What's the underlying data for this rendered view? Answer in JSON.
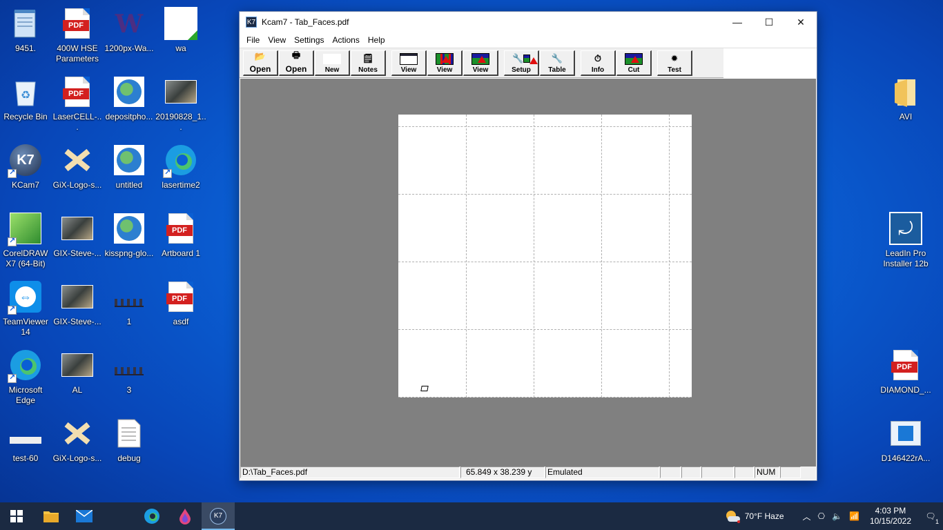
{
  "desktop": {
    "icons": [
      {
        "label": "9451.",
        "kind": "notepad"
      },
      {
        "label": "400W HSE Parameters",
        "kind": "pdf"
      },
      {
        "label": "1200px-Wa...",
        "kind": "w-logo"
      },
      {
        "label": "wa",
        "kind": "qr"
      },
      {
        "label": "Recycle Bin",
        "kind": "recycle"
      },
      {
        "label": "LaserCELL-...",
        "kind": "pdf"
      },
      {
        "label": "depositpho...",
        "kind": "globe"
      },
      {
        "label": "20190828_1...",
        "kind": "photo"
      },
      {
        "label": "KCam7",
        "kind": "kcam"
      },
      {
        "label": "GiX-Logo-s...",
        "kind": "gix"
      },
      {
        "label": "untitled",
        "kind": "globe"
      },
      {
        "label": "lasertime2",
        "kind": "edge"
      },
      {
        "label": "CorelDRAW X7 (64-Bit)",
        "kind": "corel"
      },
      {
        "label": "GIX-Steve-...",
        "kind": "photo"
      },
      {
        "label": "kisspng-glo...",
        "kind": "globe"
      },
      {
        "label": "Artboard 1",
        "kind": "pdf"
      },
      {
        "label": "TeamViewer 14",
        "kind": "teamviewer"
      },
      {
        "label": "GIX-Steve-...",
        "kind": "photo"
      },
      {
        "label": "1",
        "kind": "small"
      },
      {
        "label": "asdf",
        "kind": "pdf"
      },
      {
        "label": "Microsoft Edge",
        "kind": "edge"
      },
      {
        "label": "AL",
        "kind": "photo"
      },
      {
        "label": "3",
        "kind": "small"
      },
      {
        "label": "test-60",
        "kind": "bar"
      },
      {
        "label": "GiX-Logo-s...",
        "kind": "gix"
      },
      {
        "label": "debug",
        "kind": "text"
      },
      {
        "label": "AVI",
        "kind": "folder"
      },
      {
        "label": "LeadIn Pro Installer 12b",
        "kind": "installer"
      },
      {
        "label": "DIAMOND_...",
        "kind": "pdf"
      },
      {
        "label": "D146422rA...",
        "kind": "window"
      }
    ],
    "pdf_tag": "PDF"
  },
  "window": {
    "title": "Kcam7 - Tab_Faces.pdf",
    "app_icon": "K7",
    "controls": {
      "minimize": "—",
      "maximize": "☐",
      "close": "✕"
    },
    "menu": [
      "File",
      "View",
      "Settings",
      "Actions",
      "Help"
    ],
    "toolbar": [
      {
        "label": "Open",
        "icon": "folder-open-icon"
      },
      {
        "label": "Open",
        "icon": "printer-icon"
      },
      {
        "label": "New",
        "icon": "blank-page-icon"
      },
      {
        "label": "Notes",
        "icon": "notepad-icon"
      },
      {
        "label": "View",
        "icon": "view-blank-icon"
      },
      {
        "label": "View",
        "icon": "view-grid-icon"
      },
      {
        "label": "View",
        "icon": "view-image-icon"
      },
      {
        "label": "Setup",
        "icon": "setup-icon"
      },
      {
        "label": "Table",
        "icon": "wrench-icon"
      },
      {
        "label": "Info",
        "icon": "info-clock-icon"
      },
      {
        "label": "Cut",
        "icon": "cut-image-icon"
      },
      {
        "label": "Test",
        "icon": "test-icon"
      }
    ],
    "status": {
      "file": "D:\\Tab_Faces.pdf",
      "coords": "65.849 x    38.239 y",
      "mode": "Emulated",
      "num": "NUM"
    }
  },
  "taskbar": {
    "weather": "70°F  Haze",
    "time": "4:03 PM",
    "date": "10/15/2022",
    "notifications": "1"
  }
}
